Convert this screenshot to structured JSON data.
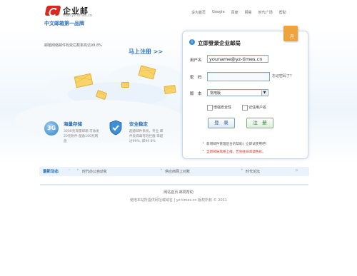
{
  "logo": {
    "title": "企业邮",
    "url": "mail.yz-times.cn"
  },
  "slogan": "中文邮箱第一品牌",
  "top_nav": [
    "设为首页",
    "Google",
    "百度",
    "网易",
    "时代广场",
    "帮助"
  ],
  "promo_text": "邮箱网络邮件有效拦截率高达99.8%",
  "register_link": "马上注册 >>",
  "features": [
    {
      "icon": "3g-icon",
      "icon_text": "3G",
      "title": "海量存储",
      "desc": "3000兆海量邮箱 可收发20兆附件 配备100兆网盘"
    },
    {
      "icon": "shield-icon",
      "title": "安全稳定",
      "desc": "超级邮件系统，专业 邮件反病毒有效拦截 率超过99%, 即99.8%"
    }
  ],
  "login": {
    "title": "立即登录企业邮局",
    "calendar_text": "月",
    "username_label": "用户名",
    "username_value": "youname@yz-times.cn",
    "password_label": "密　码",
    "forgot_label": "忘记密码了?",
    "version_label": "版　本",
    "version_value": "常用版",
    "secure_label": "增强安全性",
    "remember_label": "记住用户名",
    "login_button": "登　录",
    "register_button": "注　册",
    "notice1": "新增邮件管理后台的帮助 | 立即试使用吧！",
    "notice2": "全新邮局风格上线，告别往日单调色彩。"
  },
  "ticker": {
    "label": "最新动态",
    "items": [
      "时代办公自动化",
      "供应商网上对账",
      "时代论坛"
    ]
  },
  "footer": {
    "links": "网站首页 邮局帮助",
    "copy": "使用本站所提供网址或域名 | yz-times.cn 版权所有 © 2011"
  },
  "colors": {
    "accent": "#2c6fb3",
    "notice_red": "#d22a1a",
    "brand_red": "#d9281f"
  }
}
